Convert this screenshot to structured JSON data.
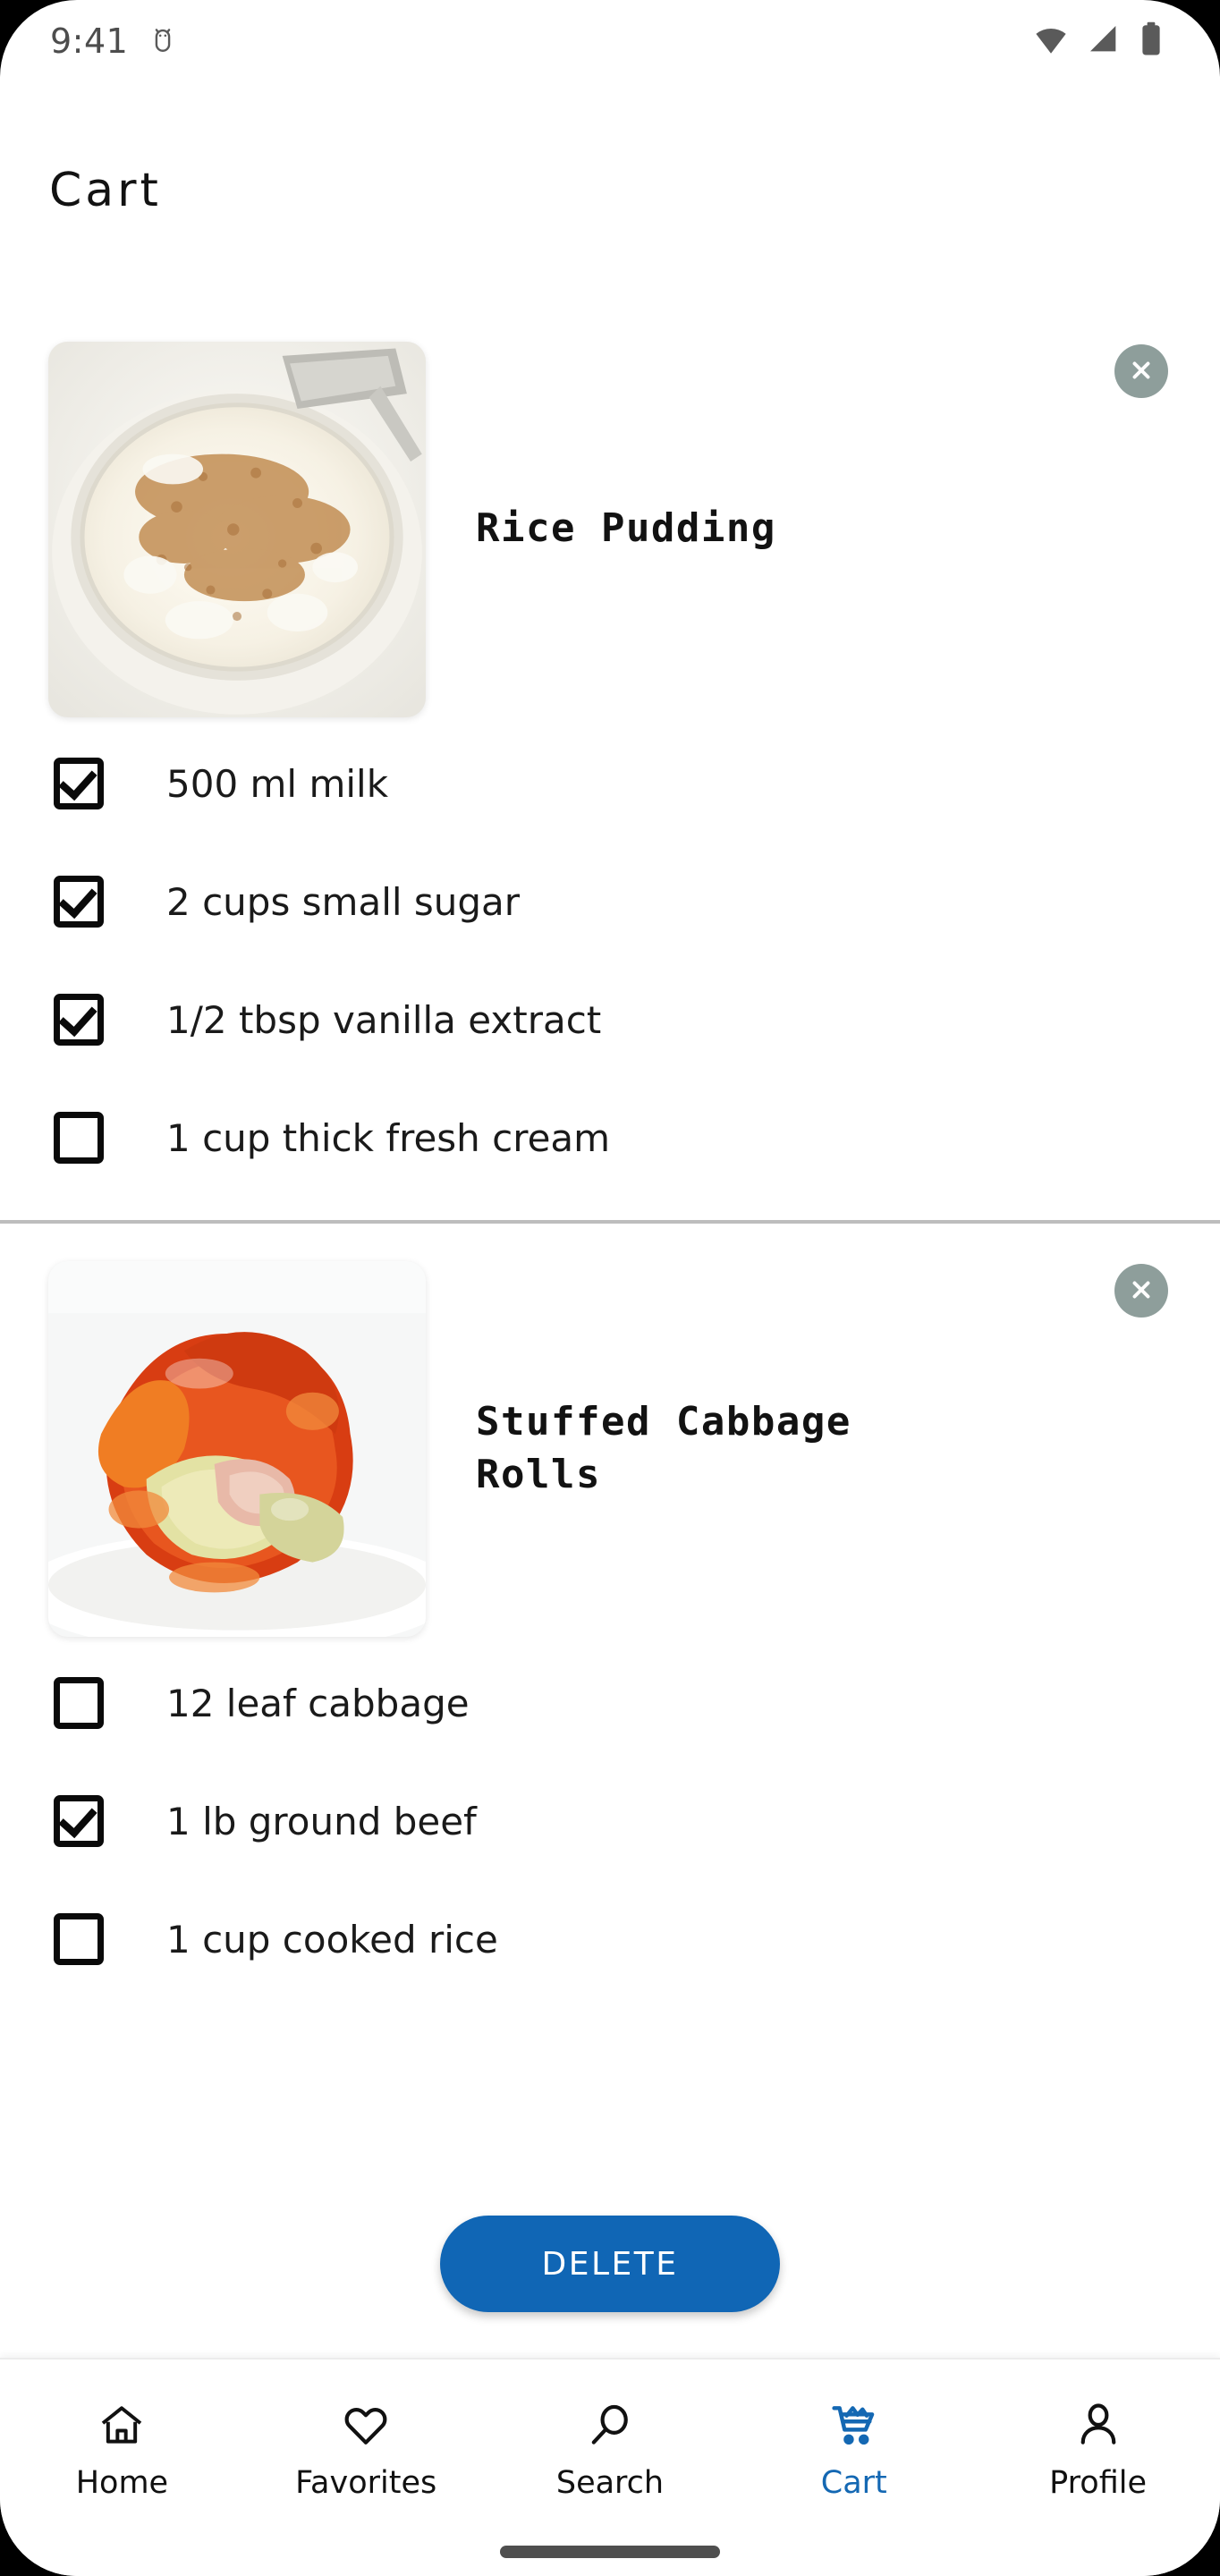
{
  "status_bar": {
    "time": "9:41",
    "icons": [
      "android-bug-icon",
      "wifi-icon",
      "cellular-signal-icon",
      "battery-icon"
    ]
  },
  "header": {
    "title": "Cart"
  },
  "colors": {
    "accent_blue": "#1468b3",
    "delete_button": "#1066b5",
    "remove_badge": "#8e9e9b",
    "divider": "#bdbdbd",
    "text_primary": "#1a1a1a"
  },
  "cart": {
    "items": [
      {
        "name": "Rice Pudding",
        "image_alt": "rice-pudding-bowl",
        "remove_label": "close-icon",
        "ingredients": [
          {
            "label": "500 ml milk",
            "checked": true
          },
          {
            "label": "2 cups small sugar",
            "checked": true
          },
          {
            "label": "1/2 tbsp vanilla extract",
            "checked": true
          },
          {
            "label": "1 cup thick fresh cream",
            "checked": false
          }
        ]
      },
      {
        "name": "Stuffed Cabbage Rolls",
        "image_alt": "stuffed-cabbage-rolls-plate",
        "remove_label": "close-icon",
        "ingredients": [
          {
            "label": "12 leaf cabbage",
            "checked": false
          },
          {
            "label": "1 lb ground beef",
            "checked": true
          },
          {
            "label": "1 cup cooked rice",
            "checked": false
          }
        ]
      }
    ]
  },
  "actions": {
    "delete_label": "DELETE"
  },
  "bottom_nav": {
    "items": [
      {
        "label": "Home",
        "icon": "home-icon",
        "active": false
      },
      {
        "label": "Favorites",
        "icon": "heart-icon",
        "active": false
      },
      {
        "label": "Search",
        "icon": "search-icon",
        "active": false
      },
      {
        "label": "Cart",
        "icon": "shopping-cart-icon",
        "active": true
      },
      {
        "label": "Profile",
        "icon": "person-icon",
        "active": false
      }
    ]
  }
}
